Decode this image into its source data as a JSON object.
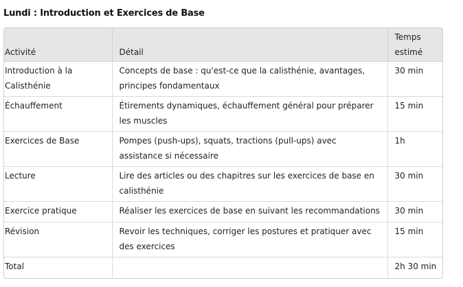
{
  "heading": "Lundi : Introduction et Exercices de Base",
  "table": {
    "headers": [
      "Activité",
      "Détail",
      "Temps estimé"
    ],
    "rows": [
      {
        "activite": "Introduction à la Calisthénie",
        "detail": "Concepts de base : qu'est-ce que la calisthénie, avantages, principes fondamentaux",
        "temps": "30 min"
      },
      {
        "activite": "Échauffement",
        "detail": "Étirements dynamiques, échauffement général pour préparer les muscles",
        "temps": "15 min"
      },
      {
        "activite": "Exercices de Base",
        "detail": "Pompes (push-ups), squats, tractions (pull-ups) avec assistance si nécessaire",
        "temps": "1h"
      },
      {
        "activite": "Lecture",
        "detail": "Lire des articles ou des chapitres sur les exercices de base en calisthénie",
        "temps": "30 min"
      },
      {
        "activite": "Exercice pratique",
        "detail": "Réaliser les exercices de base en suivant les recommandations",
        "temps": "30 min"
      },
      {
        "activite": "Révision",
        "detail": "Revoir les techniques, corriger les postures et pratiquer avec des exercices",
        "temps": "15 min"
      },
      {
        "activite": "Total",
        "detail": "",
        "temps": "2h 30 min"
      }
    ]
  }
}
